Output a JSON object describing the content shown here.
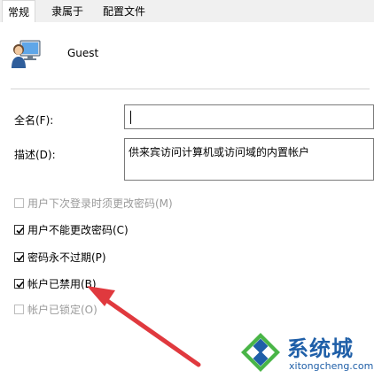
{
  "tabs": [
    {
      "label": "常规"
    },
    {
      "label": "隶属于"
    },
    {
      "label": "配置文件"
    }
  ],
  "user": {
    "name": "Guest"
  },
  "fields": {
    "fullname_label": "全名(F):",
    "fullname_value": "",
    "description_label": "描述(D):",
    "description_value": "供来宾访问计算机或访问域的内置帐户"
  },
  "checkboxes": [
    {
      "label": "用户下次登录时须更改密码(M)",
      "checked": false,
      "disabled": true
    },
    {
      "label": "用户不能更改密码(C)",
      "checked": true,
      "disabled": false
    },
    {
      "label": "密码永不过期(P)",
      "checked": true,
      "disabled": false
    },
    {
      "label": "帐户已禁用(B)",
      "checked": true,
      "disabled": false
    },
    {
      "label": "帐户已锁定(O)",
      "checked": false,
      "disabled": true
    }
  ],
  "watermark": {
    "brand": "系统城",
    "url": "xitongcheng.com"
  },
  "colors": {
    "annotation_arrow": "#e0393e",
    "watermark_blue": "#1f5fa8",
    "logo_green": "#49b547"
  }
}
